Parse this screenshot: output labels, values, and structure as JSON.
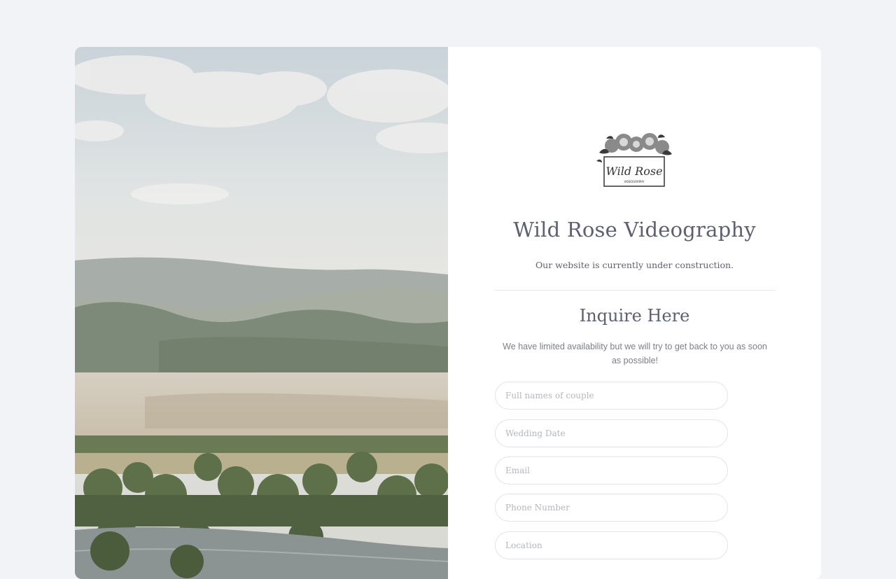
{
  "brand": {
    "title": "Wild Rose Videography",
    "tagline": "Our website is currently under construction.",
    "logo_text": "Wild Rose",
    "logo_subtext": "VIDEOGRAPHY"
  },
  "inquiry": {
    "heading": "Inquire Here",
    "description": "We have limited availability but we will try to get back to you as soon as possible!",
    "fields": {
      "names_placeholder": "Full names of couple",
      "date_placeholder": "Wedding Date",
      "email_placeholder": "Email",
      "phone_placeholder": "Phone Number",
      "location_placeholder": "Location"
    }
  },
  "colors": {
    "background": "#f1f3f7",
    "text": "#5b6170",
    "muted": "#7b7f8a",
    "input_border": "#e1e4ea"
  },
  "icons": {
    "logo": "rose-wreath-logo"
  }
}
